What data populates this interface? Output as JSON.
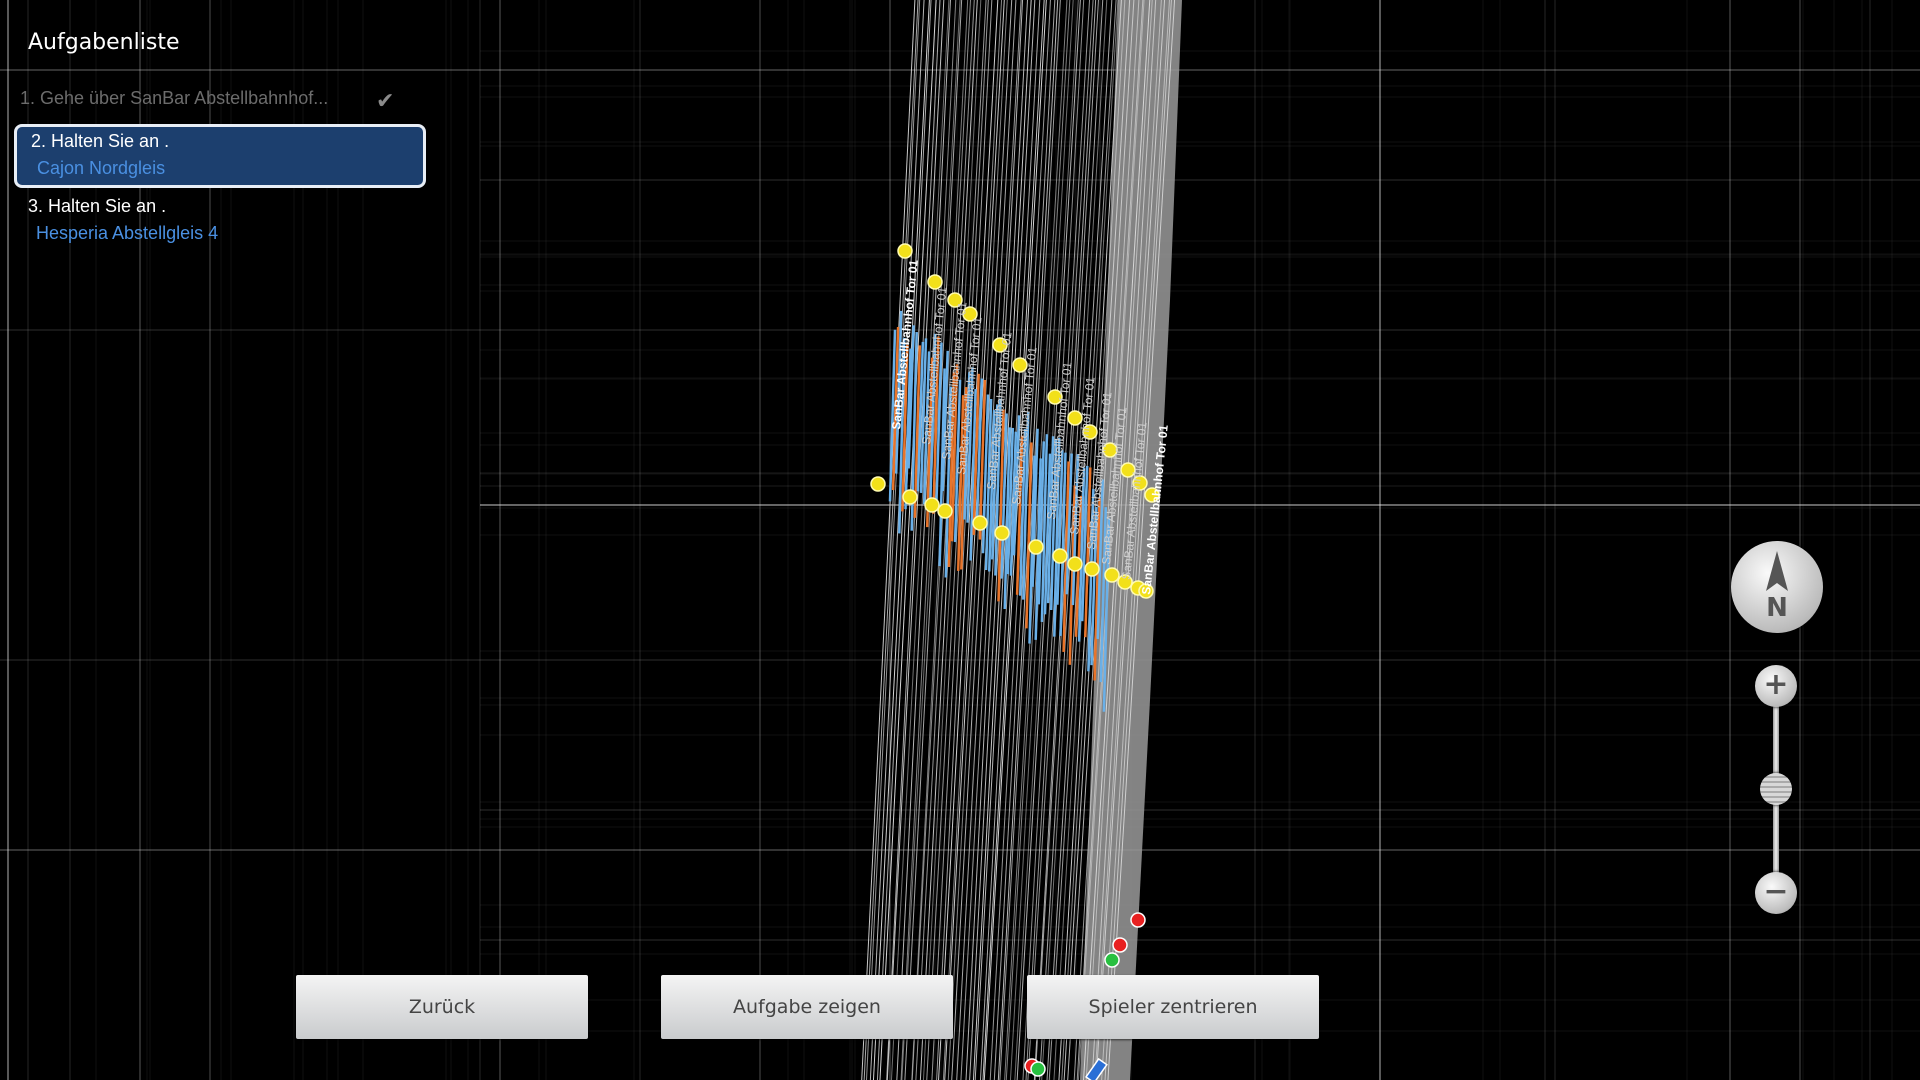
{
  "task_list": {
    "title": "Aufgabenliste",
    "tasks": [
      {
        "line1": "1. Gehe über  SanBar Abstellbahnhof...",
        "line2": "",
        "status": "done",
        "check_icon": "checkmark-icon"
      },
      {
        "line1": "2. Halten Sie an  .",
        "line2": "Cajon Nordgleis",
        "status": "active"
      },
      {
        "line1": "3. Halten Sie an  .",
        "line2": "Hesperia Abstellgleis 4",
        "status": "pending"
      }
    ]
  },
  "buttons": {
    "back": "Zurück",
    "show_task": "Aufgabe zeigen",
    "center_player": "Spieler zentrieren"
  },
  "map_controls": {
    "compass_label": "N",
    "compass_icon": "north-arrow-icon",
    "zoom_in_icon": "plus-icon",
    "zoom_out_icon": "minus-icon",
    "zoom_level": 0.55
  },
  "map": {
    "track_labels": [
      "SanBar Abstellbahnhof Tor 01"
    ],
    "colors": {
      "background": "#000000",
      "grid": "#ffffff",
      "tracks": "#d8d8d8",
      "signal_yellow": "#f2e01a",
      "track_blue": "#6ab0e8",
      "track_orange": "#e8742a",
      "signal_red": "#e82020",
      "signal_green": "#28c040",
      "active_task_bg": "#1c3f6e",
      "link_blue": "#4a90e2"
    }
  }
}
